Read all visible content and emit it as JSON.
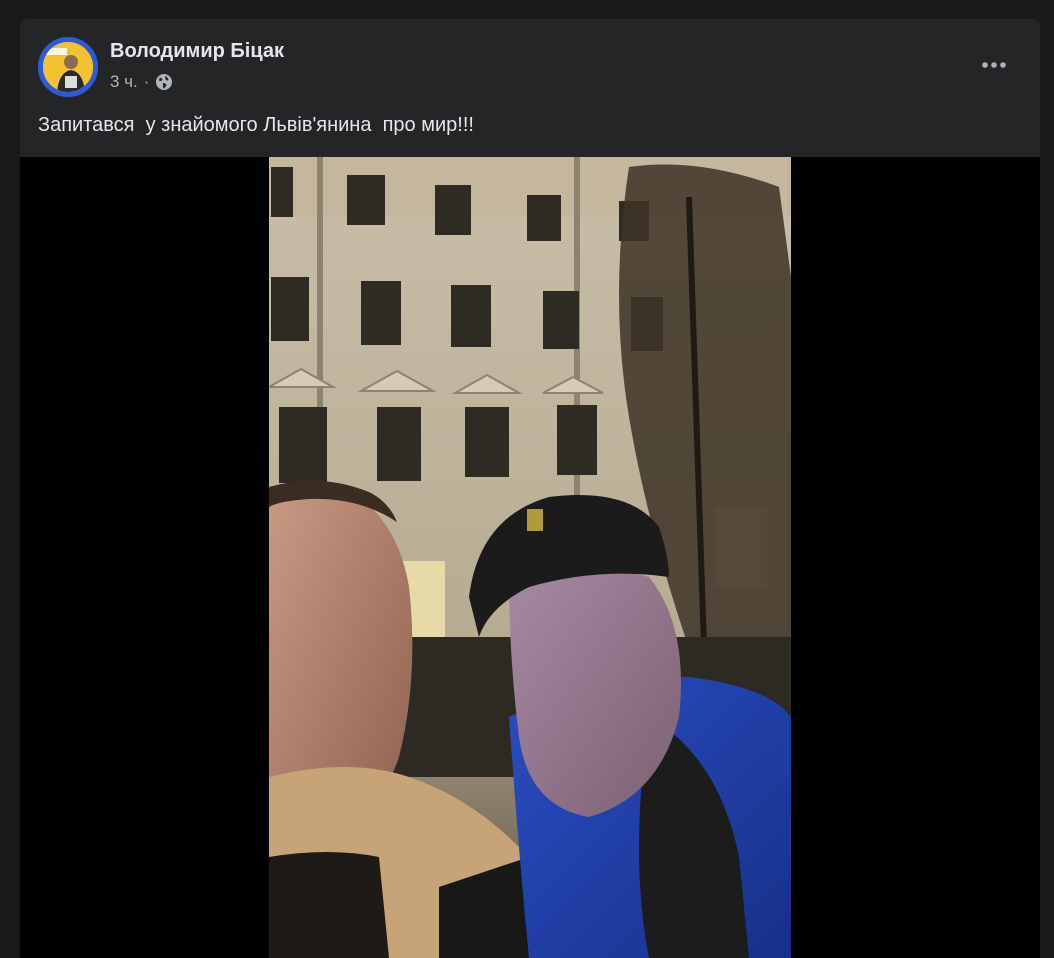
{
  "post": {
    "author": "Володимир Біцак",
    "time": "3 ч.",
    "separator": "·",
    "privacy_icon": "globe-icon",
    "more_icon": "more-options-icon",
    "text": "Запитався  у знайомого Львів'янина  про мир!!!",
    "media_type": "video"
  },
  "colors": {
    "page_background": "#18191a",
    "card_background": "#242526",
    "primary_text": "#e4e6eb",
    "secondary_text": "#b0b3b8",
    "avatar_ring": "#2d5bd8"
  }
}
